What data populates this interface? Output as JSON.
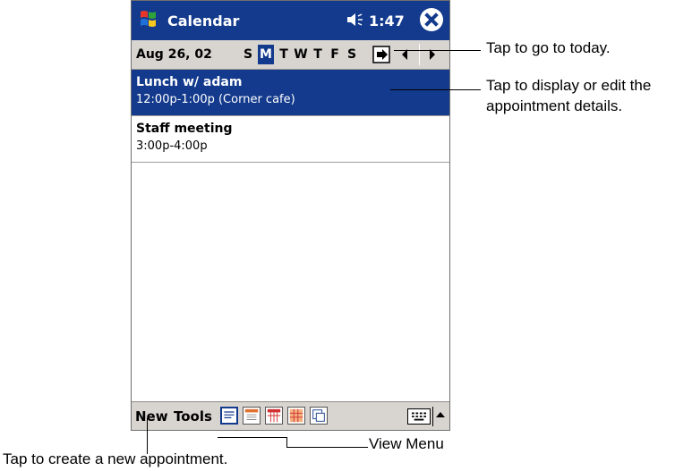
{
  "titlebar": {
    "app_title": "Calendar",
    "clock": "1:47"
  },
  "datebar": {
    "date": "Aug 26, 02",
    "days": [
      "S",
      "M",
      "T",
      "W",
      "T",
      "F",
      "S"
    ],
    "selected_day_index": 1
  },
  "appointments": [
    {
      "title": "Lunch w/ adam",
      "detail": "12:00p-1:00p (Corner cafe)",
      "selected": true
    },
    {
      "title": "Staff meeting",
      "detail": "3:00p-4:00p",
      "selected": false
    }
  ],
  "cmdbar": {
    "new_label": "New",
    "tools_label": "Tools"
  },
  "icons": [
    "windows-start-icon",
    "speaker-icon",
    "close-icon",
    "go-to-today-icon",
    "agenda-view-icon",
    "day-view-icon",
    "week-view-icon",
    "month-view-icon",
    "year-view-icon",
    "keyboard-icon"
  ],
  "callouts": {
    "today": "Tap to go to today.",
    "details_line1": "Tap to display or edit the",
    "details_line2": "appointment details.",
    "view_menu": "View Menu",
    "new_appt": "Tap to create a new appointment."
  },
  "colors": {
    "titlebar": "#133a8c",
    "selection": "#133a8c",
    "bar": "#d8d4d0"
  }
}
